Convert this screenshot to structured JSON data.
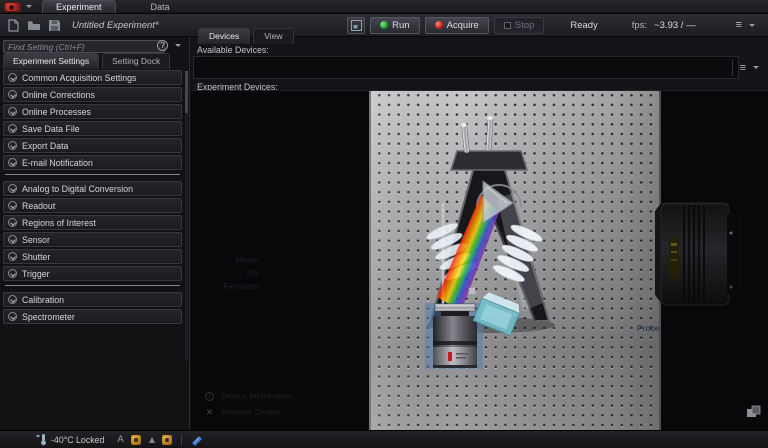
{
  "titlebar": {
    "tabs": [
      {
        "label": "Experiment"
      },
      {
        "label": "Data"
      }
    ]
  },
  "toolbar": {
    "document_title": "Untitled Experiment*",
    "run_label": "Run",
    "acquire_label": "Acquire",
    "stop_label": "Stop",
    "status_text": "Ready",
    "fps_label": "fps:",
    "fps_value": "~3.93 / —"
  },
  "left_panel": {
    "search_placeholder": "Find Setting (Ctrl+F)",
    "tabs": [
      {
        "label": "Experiment Settings"
      },
      {
        "label": "Setting Dock"
      }
    ],
    "groups": [
      {
        "items": [
          "Common Acquisition Settings",
          "Online Corrections",
          "Online Processes",
          "Save Data File",
          "Export Data",
          "E-mail Notification"
        ]
      },
      {
        "items": [
          "Analog to Digital Conversion",
          "Readout",
          "Regions of Interest",
          "Sensor",
          "Shutter",
          "Trigger"
        ]
      },
      {
        "items": [
          "Calibration",
          "Spectrometer"
        ]
      }
    ]
  },
  "right_panel": {
    "tabs": [
      {
        "label": "Devices"
      },
      {
        "label": "View"
      }
    ],
    "available_devices_label": "Available Devices:",
    "experiment_devices_label": "Experiment Devices:",
    "canvas": {
      "device_info_lines": [
        {
          "label": "Model:",
          "value": ""
        },
        {
          "label": "SN:",
          "value": ""
        },
        {
          "label": "Firmware:",
          "value": ""
        }
      ],
      "context_actions": [
        {
          "label": "Device Information..."
        },
        {
          "label": "Remove Device"
        }
      ],
      "probe_label": "Probe"
    }
  },
  "statusbar": {
    "temperature_text": "-40°C Locked"
  },
  "icons": {
    "app_logo": "red-shutter-logo",
    "toolbar": [
      "new-experiment-icon",
      "open-icon",
      "save-icon"
    ],
    "run": "green-dot",
    "acquire": "red-dot",
    "stop": "gray-square",
    "menus": "hamburger-with-caret",
    "help": "circled-question-mark",
    "canvas_corner": "layered-windows-icon",
    "statusbar": [
      "thermometer-icon",
      "letter-a-icon",
      "orange-status-icon",
      "triangle-icon",
      "orange-status-icon",
      "blue-signal-icon"
    ]
  },
  "colors": {
    "accent_red": "#c3231a",
    "run_green": "#1f9a2f",
    "selection_blue": "#4f7fb8",
    "status_orange": "#b07a18",
    "board_gray": "#a8a8aa",
    "panel_dark": "#141418"
  }
}
